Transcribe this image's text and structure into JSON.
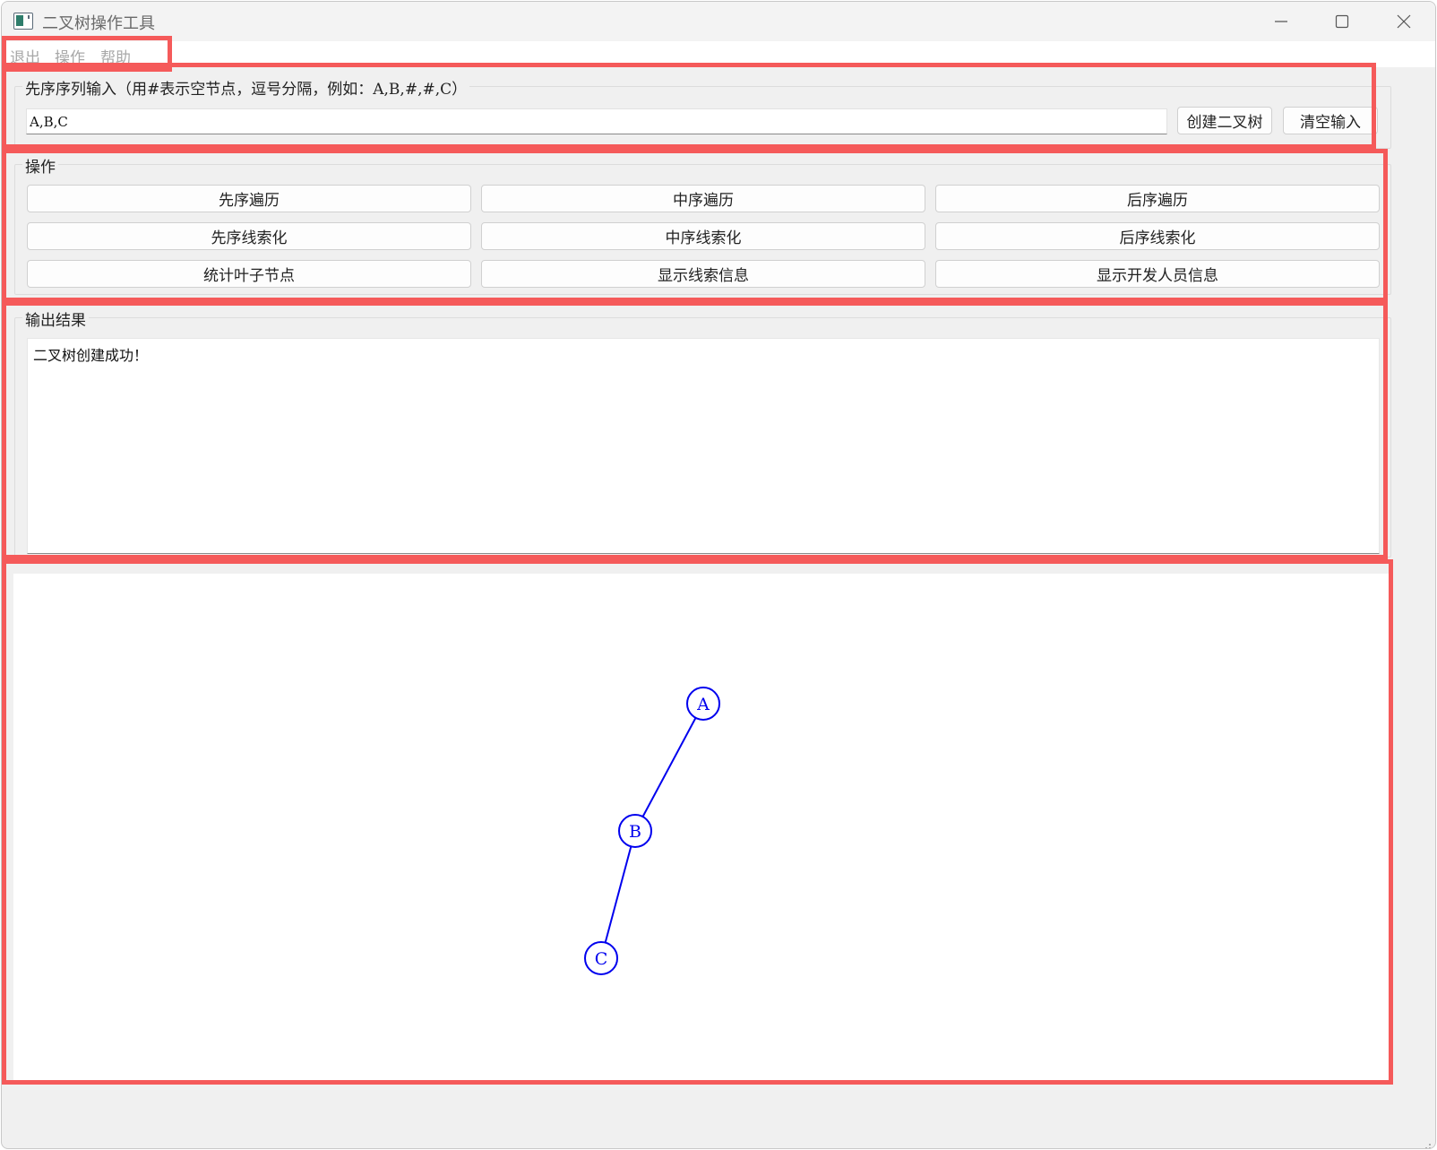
{
  "window": {
    "title": "二叉树操作工具",
    "controls": [
      "minimize",
      "maximize",
      "close"
    ]
  },
  "menu": {
    "items": [
      "退出",
      "操作",
      "帮助"
    ]
  },
  "input_group": {
    "title": "先序序列输入（用#表示空节点，逗号分隔，例如：A,B,#,#,C）",
    "input_value": "A,B,C",
    "create_button": "创建二叉树",
    "clear_button": "清空输入"
  },
  "ops_group": {
    "title": "操作",
    "buttons": [
      "先序遍历",
      "中序遍历",
      "后序遍历",
      "先序线索化",
      "中序线索化",
      "后序线索化",
      "统计叶子节点",
      "显示线索信息",
      "显示开发人员信息"
    ]
  },
  "output_group": {
    "title": "输出结果",
    "text": "二叉树创建成功！"
  },
  "tree": {
    "color": "#0000ee",
    "nodes": [
      {
        "id": "A",
        "label": "A"
      },
      {
        "id": "B",
        "label": "B"
      },
      {
        "id": "C",
        "label": "C"
      }
    ],
    "edges": [
      {
        "from": "A",
        "to": "B"
      },
      {
        "from": "B",
        "to": "C"
      }
    ]
  },
  "colors": {
    "annotation": "#f55a5a",
    "tree_stroke": "#0000ee"
  }
}
